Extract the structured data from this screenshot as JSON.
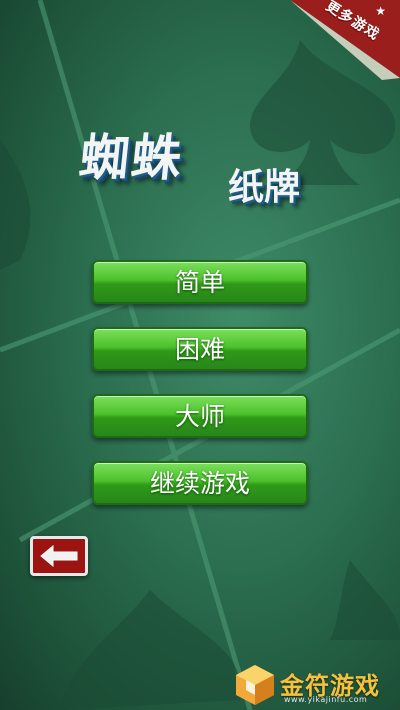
{
  "corner_ribbon": {
    "label": "更多游戏",
    "star": "★"
  },
  "title": {
    "main": "蜘蛛",
    "sub": "纸牌"
  },
  "menu": {
    "easy": "简单",
    "hard": "困难",
    "master": "大师",
    "continue": "继续游戏"
  },
  "watermark": {
    "text": "金符游戏",
    "url": "www.yikajinfu.com"
  },
  "colors": {
    "felt": "#2b6e50",
    "button_green": "#4cc12c",
    "back_red": "#9b1412",
    "ribbon_red": "#9a1e1c",
    "watermark_gold": "#f7c13a"
  },
  "icons": {
    "back": "back-arrow-icon",
    "logo": "cube-logo-icon"
  }
}
